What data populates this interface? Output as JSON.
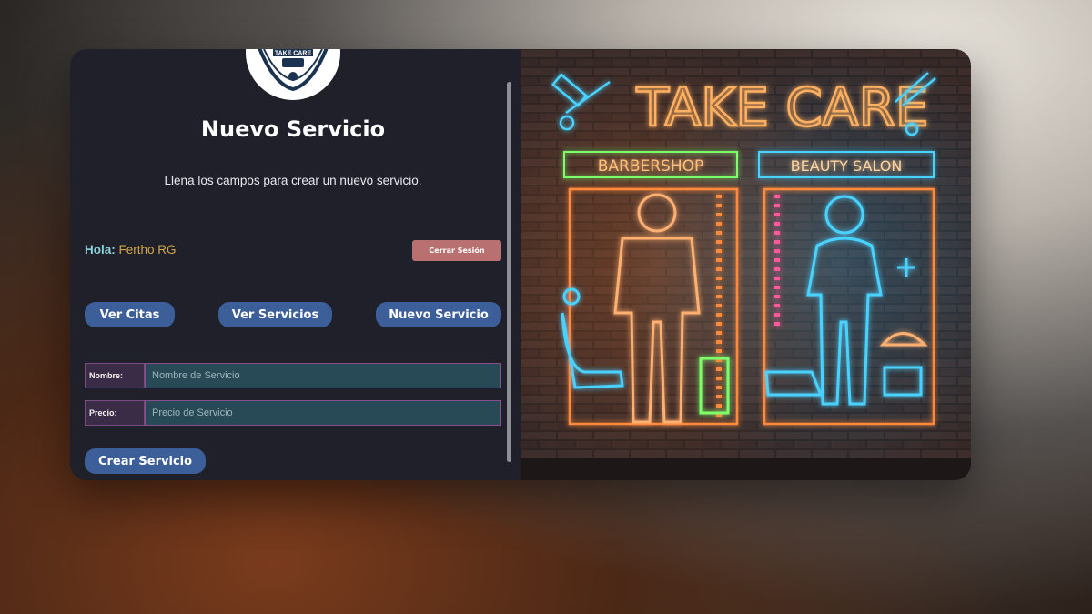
{
  "form": {
    "title": "Nuevo Servicio",
    "subtitle": "Llena los campos para crear un nuevo servicio.",
    "greeting_label": "Hola:",
    "user_name": "Fertho RG",
    "logout_label": "Cerrar Sesión",
    "nav": [
      "Ver Citas",
      "Ver Servicios",
      "Nuevo Servicio"
    ],
    "fields": [
      {
        "label": "Nombre:",
        "placeholder": "Nombre de Servicio",
        "value": ""
      },
      {
        "label": "Precio:",
        "placeholder": "Precio de Servicio",
        "value": ""
      }
    ],
    "submit_label": "Crear Servicio",
    "logo_text": "TAKE CARE"
  },
  "art": {
    "headline": "TAKE CARE",
    "left_sign": "BARBERSHOP",
    "right_sign": "BEAUTY SALON"
  },
  "colors": {
    "panel_bg": "#1f2029",
    "button": "#3c5f9a",
    "logout": "#b97070",
    "neon_orange": "#ff9a4a",
    "neon_blue": "#3fc4ff",
    "neon_green": "#8dff64"
  }
}
